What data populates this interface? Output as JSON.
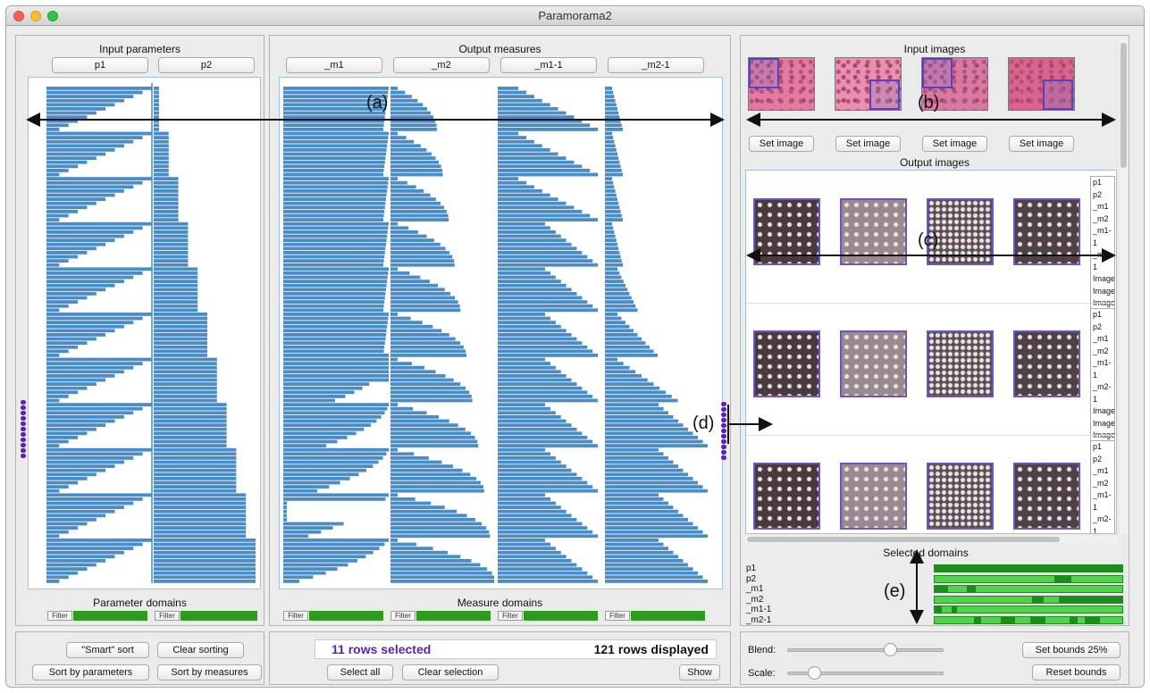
{
  "window": {
    "title": "Paramorama2",
    "traffic_colors": [
      "#fc5f57",
      "#fdbc2e",
      "#28c840"
    ]
  },
  "input_panel": {
    "title": "Input parameters",
    "columns": [
      "p1",
      "p2"
    ],
    "footer": "Parameter domains",
    "filter_label": "Filter"
  },
  "output_panel": {
    "title": "Output measures",
    "columns": [
      "_m1",
      "_m2",
      "_m1-1",
      "_m2-1"
    ],
    "footer": "Measure domains",
    "filter_label": "Filter"
  },
  "image_panel": {
    "input_title": "Input images",
    "output_title": "Output images",
    "set_image_label": "Set image",
    "set_image_count": 4,
    "row_tags": [
      "p1",
      "p2",
      "_m1",
      "_m2",
      "_m1-1",
      "_m2-1",
      "Image",
      "Image",
      "Image",
      "Image"
    ]
  },
  "selected_domains": {
    "title": "Selected domains",
    "rows": [
      "p1",
      "p2",
      "_m1",
      "_m2",
      "_m1-1",
      "_m2-1"
    ]
  },
  "annotations": {
    "a": "(a)",
    "b": "(b)",
    "c": "(c)",
    "d": "(d)",
    "e": "(e)"
  },
  "bottom_left": {
    "smart_sort": "\"Smart\" sort",
    "clear_sorting": "Clear sorting",
    "sort_params": "Sort by parameters",
    "sort_measures": "Sort by measures"
  },
  "bottom_mid": {
    "rows_selected": "11 rows selected",
    "rows_displayed": "121 rows displayed",
    "select_all": "Select all",
    "clear_selection": "Clear selection",
    "show": "Show"
  },
  "bottom_right": {
    "blend_label": "Blend:",
    "scale_label": "Scale:",
    "blend_value": 0.66,
    "scale_value": 0.17,
    "set_bounds": "Set bounds 25%",
    "reset_bounds": "Reset bounds"
  },
  "colors": {
    "bar": "#4a8cc7",
    "accent": "#5a1fb5",
    "filter": "#2e9a21",
    "domain": "#52d24c",
    "domain_dark": "#1e8c1c"
  }
}
